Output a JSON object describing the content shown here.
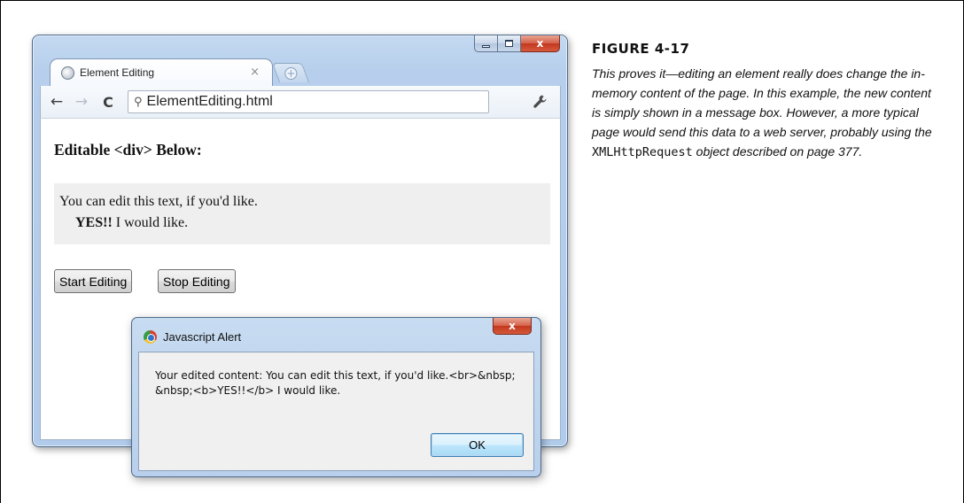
{
  "browser": {
    "tab": {
      "title": "Element Editing",
      "close_glyph": "×",
      "favicon_icon": "globe-icon"
    },
    "new_tab_glyph": "+",
    "window_controls": {
      "close_glyph": "x"
    },
    "toolbar": {
      "back_glyph": "←",
      "forward_glyph": "→",
      "reload_glyph": "C",
      "search_glyph": "⚲",
      "address": "ElementEditing.html",
      "wrench_glyph": "🔧"
    }
  },
  "page": {
    "heading": "Editable <div> Below:",
    "editable_line1": "You can edit this text, if you'd like.",
    "editable_line2_bold": "YES!!",
    "editable_line2_rest": " I would like.",
    "start_button": "Start Editing",
    "stop_button": "Stop Editing"
  },
  "alert": {
    "title": "Javascript Alert",
    "close_glyph": "x",
    "message": "Your edited content: You can edit this text, if you'd like.<br>&nbsp; &nbsp;<b>YES!!</b> I would like.",
    "ok_label": "OK"
  },
  "caption": {
    "label": "FIGURE 4-17",
    "text_before": "This proves it—editing an element really does change the in-memory content of the page. In this example, the new content is simply shown in a message box. However, a more typical page would send this data to a web server, probably using the ",
    "code": "XMLHttpRequest",
    "text_after": " object described on page 377."
  }
}
